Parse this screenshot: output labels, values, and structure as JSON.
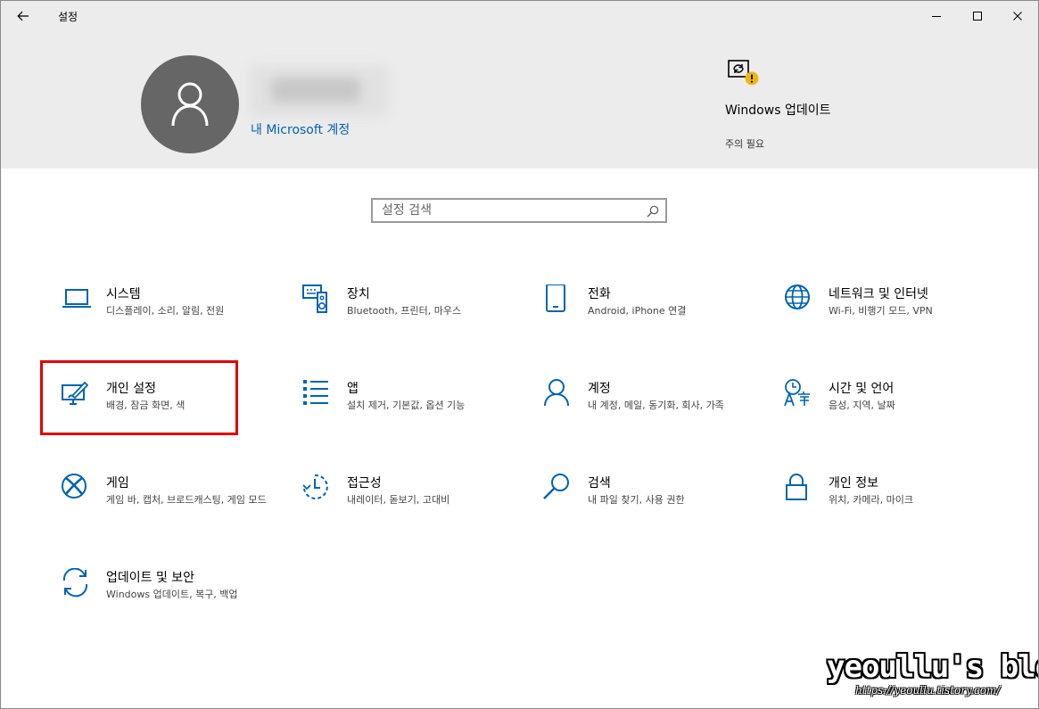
{
  "window": {
    "title": "설정",
    "controls": {
      "minimize": "minimize-icon",
      "maximize": "maximize-icon",
      "close": "close-icon"
    }
  },
  "header": {
    "account_link": "내 Microsoft 계정",
    "update": {
      "title": "Windows 업데이트",
      "status": "주의 필요"
    }
  },
  "search": {
    "placeholder": "설정 검색"
  },
  "tiles": [
    {
      "name": "시스템",
      "desc": "디스플레이, 소리, 알림, 전원",
      "icon": "laptop-icon"
    },
    {
      "name": "장치",
      "desc": "Bluetooth, 프린터, 마우스",
      "icon": "devices-icon"
    },
    {
      "name": "전화",
      "desc": "Android, iPhone 연결",
      "icon": "phone-icon"
    },
    {
      "name": "네트워크 및 인터넷",
      "desc": "Wi-Fi, 비행기 모드, VPN",
      "icon": "globe-icon"
    },
    {
      "name": "개인 설정",
      "desc": "배경, 잠금 화면, 색",
      "icon": "personalization-icon"
    },
    {
      "name": "앱",
      "desc": "설치 제거, 기본값, 옵션 기능",
      "icon": "apps-list-icon"
    },
    {
      "name": "계정",
      "desc": "내 계정, 메일, 동기화, 회사, 가족",
      "icon": "person-icon"
    },
    {
      "name": "시간 및 언어",
      "desc": "음성, 지역, 날짜",
      "icon": "time-language-icon"
    },
    {
      "name": "게임",
      "desc": "게임 바, 캡처, 브로드캐스팅, 게임 모드",
      "icon": "xbox-icon"
    },
    {
      "name": "접근성",
      "desc": "내레이터, 돋보기, 고대비",
      "icon": "accessibility-icon"
    },
    {
      "name": "검색",
      "desc": "내 파일 찾기, 사용 권한",
      "icon": "magnifier-icon"
    },
    {
      "name": "개인 정보",
      "desc": "위치, 카메라, 마이크",
      "icon": "lock-icon"
    },
    {
      "name": "업데이트 및 보안",
      "desc": "Windows 업데이트, 복구, 백업",
      "icon": "sync-icon"
    }
  ],
  "watermark": {
    "text": "yeoullu's blog",
    "url": "https://yeoullu.tistory.com/"
  },
  "colors": {
    "accent": "#0063b1",
    "header_bg": "#ececec",
    "avatar_bg": "#666666",
    "highlight": "#e00000",
    "warning": "#f2b705"
  }
}
